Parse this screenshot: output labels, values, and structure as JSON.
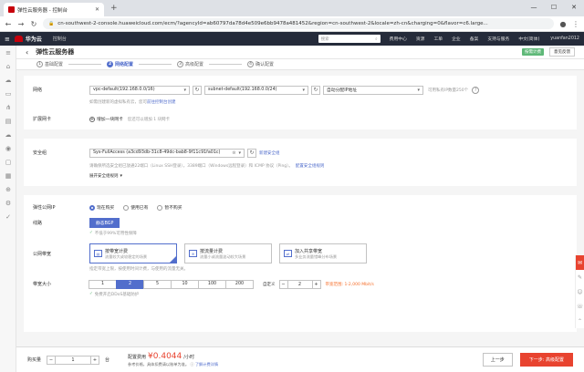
{
  "browser": {
    "tab_title": "弹性云服务器 - 控制台",
    "url": "cn-southwest-2-console.huaweicloud.com/ecm/?agencyId=ab60797da78d4e509e6bb9478a481452&region=cn-southwest-2&locale=zh-cn&charging=0&flavor=c6.large..."
  },
  "topnav": {
    "brand": "华为云",
    "console": "控制台",
    "search_placeholder": "搜索",
    "links": [
      "费用中心",
      "资源",
      "工单",
      "企业",
      "备案",
      "支持与服务",
      "中文(简体)"
    ],
    "user": "yuanfan2012"
  },
  "page": {
    "title": "弹性云服务器",
    "badge": "按需计费",
    "feedback": "意见反馈"
  },
  "steps": [
    {
      "num": "1",
      "label": "基础配置"
    },
    {
      "num": "2",
      "label": "网络配置"
    },
    {
      "num": "3",
      "label": "高级配置"
    },
    {
      "num": "4",
      "label": "确认配置"
    }
  ],
  "network": {
    "label": "网络",
    "vpc": "vpc-default(192.168.0.0/16)",
    "subnet": "subnet-default(192.168.0.0/24)",
    "ip_mode": "自动分配IP地址",
    "ip_hint": "可用私有IP数量250个",
    "hint_prefix": "如需创建新的虚拟私有云，您可",
    "hint_link": "前往控制台创建",
    "ext_nic_label": "扩展网卡",
    "add_nic": "增加一块网卡",
    "add_nic_hint": "您还可以增加 1 块网卡"
  },
  "security": {
    "label": "安全组",
    "value": "Sys-FullAccess (a3cd93db-31c8-49dc-bab8-9f11c91fa01c)",
    "new_link": "新建安全组",
    "hint": "请确保所选安全组已放通22端口（Linux SSH登录），3389端口（Windows远程登录）和 ICMP 协议（Ping）。",
    "hint_link": "配置安全组规则",
    "expand": "展开安全组规则"
  },
  "eip": {
    "label": "弹性公网IP",
    "options": [
      "现在购买",
      "使用已有",
      "暂不购买"
    ],
    "line_label": "线路",
    "line_value": "静态BGP",
    "sla": "不低于99%可用性保障",
    "billing_label": "公网带宽",
    "billing": [
      {
        "title": "按带宽计费",
        "desc": "流量较大或较稳定的场景"
      },
      {
        "title": "按流量计费",
        "desc": "流量小或流量波动较大场景"
      },
      {
        "title": "加入共享带宽",
        "desc": "多业务流量错峰分布场景"
      }
    ],
    "billing_hint": "指定带宽上限，按使用时间计费，与使用的流量无关。",
    "size_label": "带宽大小",
    "sizes": [
      "1",
      "2",
      "5",
      "10",
      "100",
      "200"
    ],
    "custom_label": "自定义",
    "custom_value": "2",
    "range_hint": "带宽范围: 1-2,000 Mbit/s",
    "ddos": "免费开启DDoS基础防护"
  },
  "footer": {
    "qty_label": "购买量",
    "qty": "1",
    "unit": "台",
    "price_label": "配置费用",
    "price": "¥0.4044",
    "price_unit": "/小时",
    "price_note": "参考价格，具体扣费请以账单为准。",
    "price_link": "了解计费详情",
    "prev": "上一步",
    "next": "下一步: 高级配置"
  }
}
